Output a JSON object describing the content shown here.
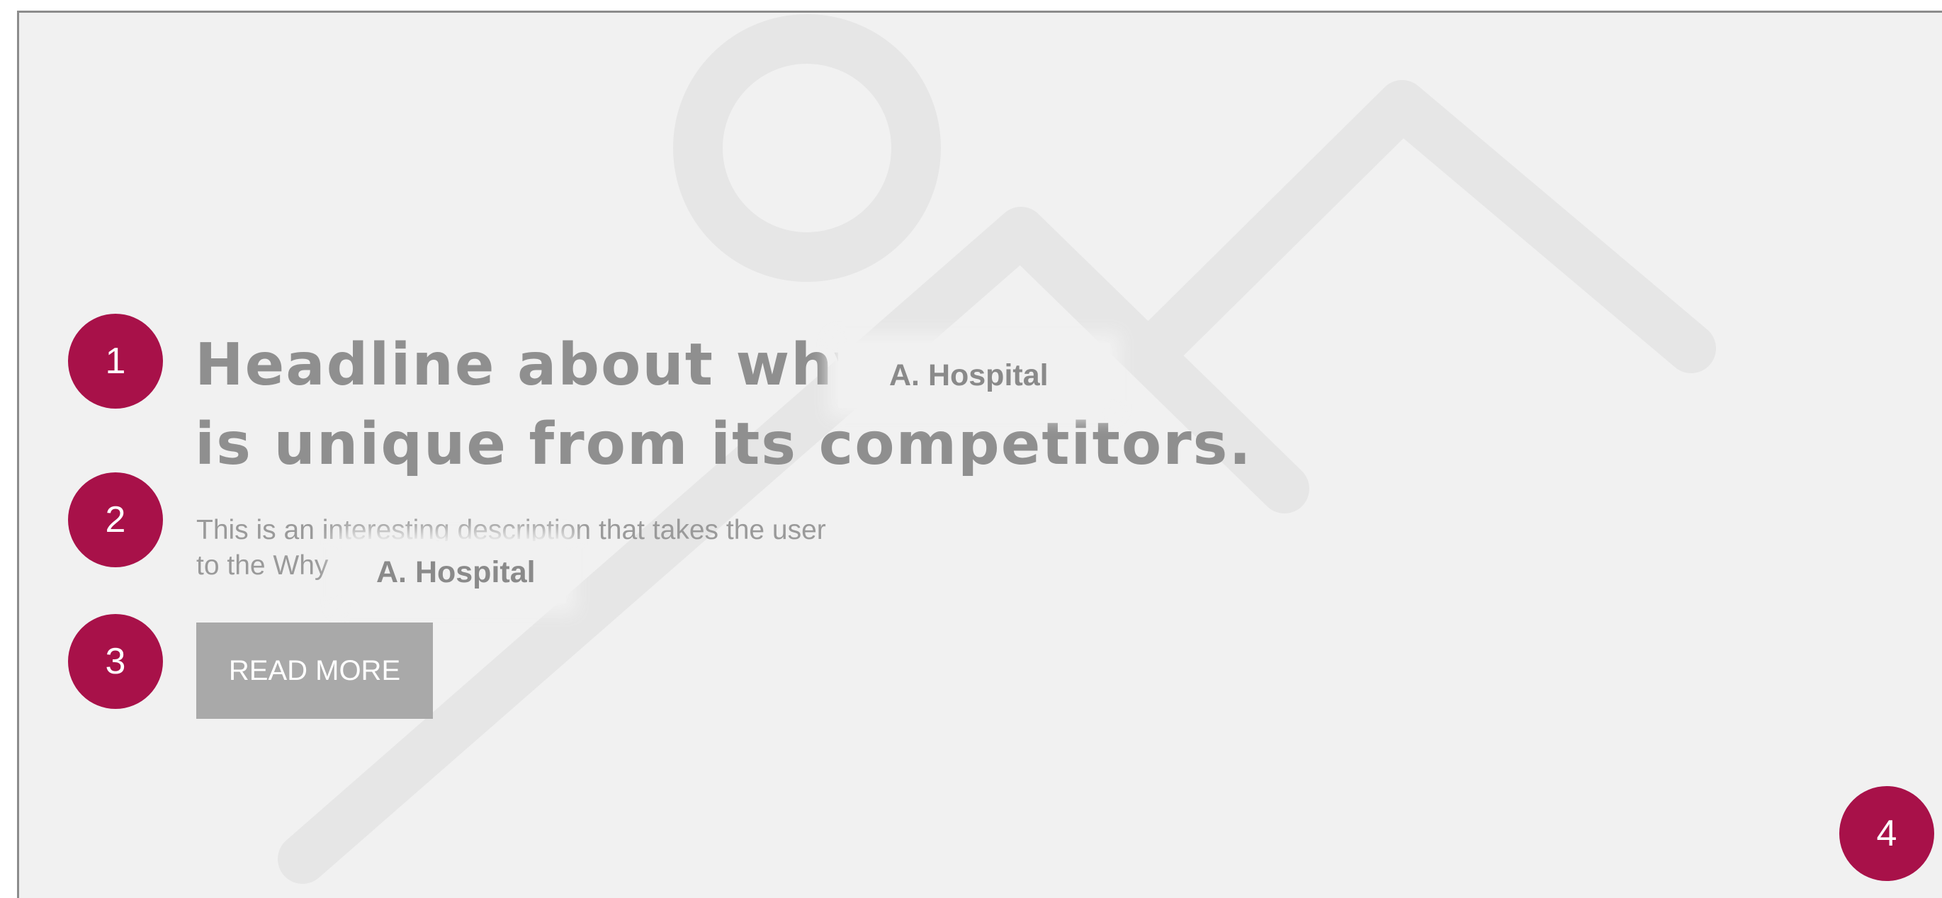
{
  "hero": {
    "headline_line1": "Headline about why",
    "headline_line2": "is unique from its competitors.",
    "description_line1": "This is an interesting description that takes the user",
    "description_line2": "to the Why",
    "cta_label": "READ MORE"
  },
  "tags": {
    "headline_tag": "A. Hospital",
    "description_tag": "A. Hospital"
  },
  "markers": [
    "1",
    "2",
    "3",
    "4"
  ],
  "placeholder_image": {
    "icon": "image-placeholder-icon"
  },
  "colors": {
    "marker": "#a81149",
    "background": "#f1f1f1",
    "button": "#a9a9a9",
    "text": "#8f8f8f"
  }
}
